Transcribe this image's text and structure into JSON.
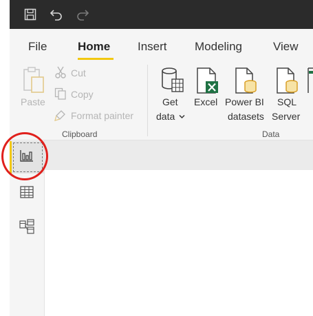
{
  "titlebar": {
    "icons": [
      "save-icon",
      "undo-icon",
      "redo-icon"
    ],
    "background": "#2b2b2b"
  },
  "tabs": [
    {
      "label": "File"
    },
    {
      "label": "Home"
    },
    {
      "label": "Insert"
    },
    {
      "label": "Modeling"
    },
    {
      "label": "View"
    }
  ],
  "active_tab": "Home",
  "accent_color": "#f2c811",
  "ribbon": {
    "clipboard": {
      "paste_label": "Paste",
      "cut_label": "Cut",
      "copy_label": "Copy",
      "format_painter_label": "Format painter",
      "group_label": "Clipboard"
    },
    "data": {
      "get_data_line1": "Get",
      "get_data_line2": "data",
      "excel_label": "Excel",
      "powerbi_line1": "Power BI",
      "powerbi_line2": "datasets",
      "sql_line1": "SQL",
      "sql_line2": "Server",
      "group_label": "Data"
    }
  },
  "views": [
    {
      "name": "report",
      "icon": "bar-chart-icon",
      "active": true
    },
    {
      "name": "data",
      "icon": "table-icon",
      "active": false
    },
    {
      "name": "model",
      "icon": "model-icon",
      "active": false
    }
  ],
  "annotation_color": "#e0201c"
}
